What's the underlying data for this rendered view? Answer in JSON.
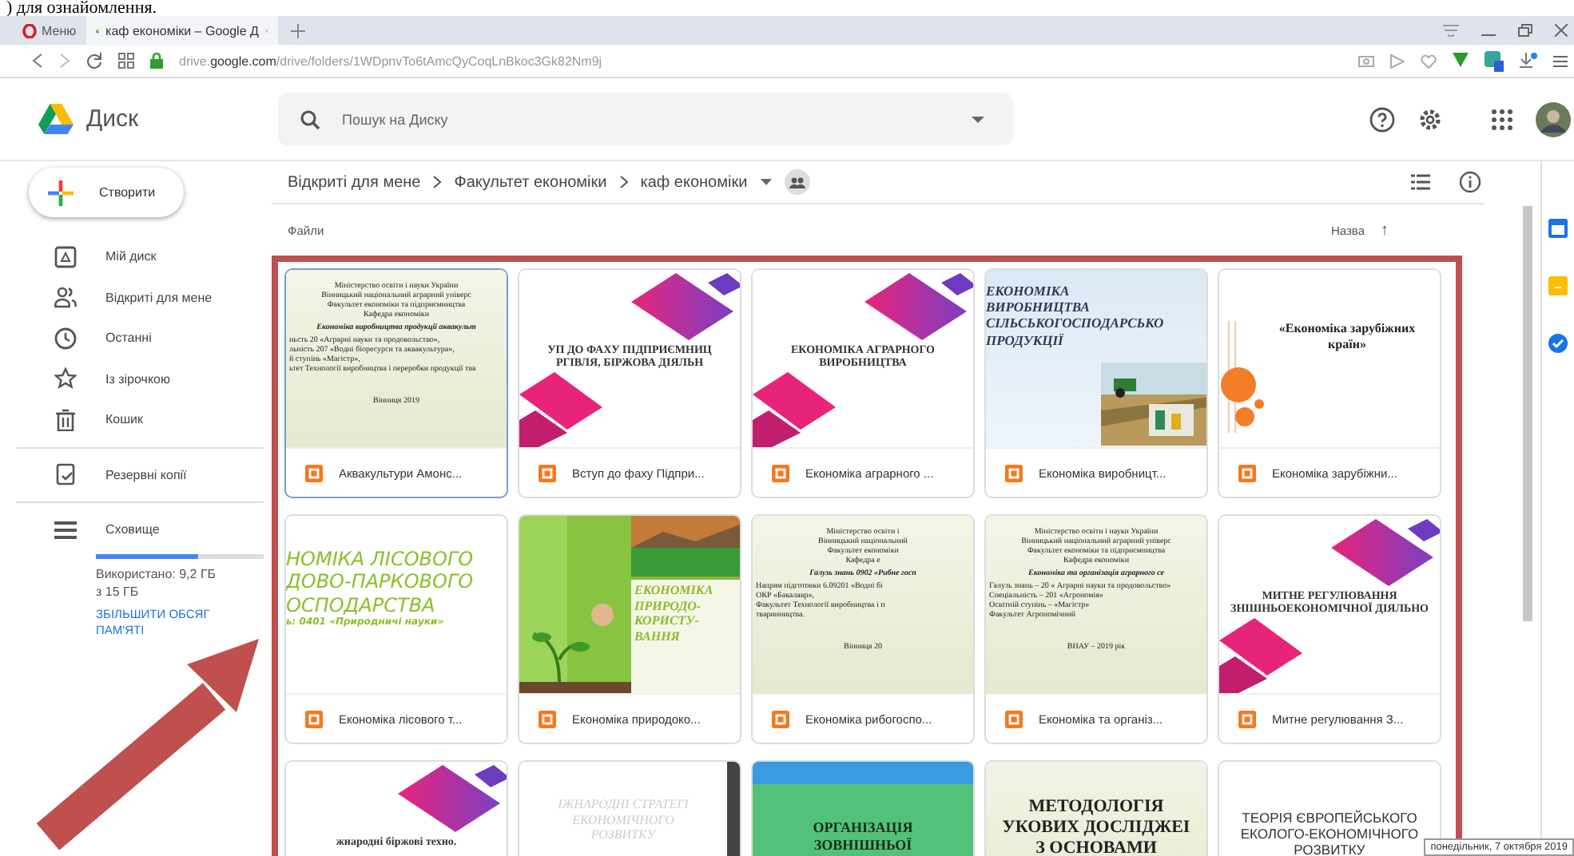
{
  "document_caption": ") для ознайомлення.",
  "browser": {
    "menu_label": "Меню",
    "tabs": [
      {
        "title": "каф економіки – Google Д",
        "selected": true
      }
    ],
    "address": "drive.**google.com**/drive/folders/1WDpnvTo6tAmcQyCoqLnBkoc3Gk82Nm9j"
  },
  "app": {
    "name": "Диск",
    "search": {
      "placeholder": "Пошук на Диску"
    }
  },
  "sidebar": {
    "create_label": "Створити",
    "items": [
      {
        "label": "Мій диск",
        "selected": false
      },
      {
        "label": "Відкриті для мене",
        "selected": false
      },
      {
        "label": "Останні",
        "selected": false
      },
      {
        "label": "Із зірочкою",
        "selected": false
      },
      {
        "label": "Кошик",
        "selected": false
      }
    ],
    "backup_label": "Резервні копії",
    "storage": {
      "label": "Сховище",
      "level": 0.61,
      "usage": "Використано: 9,2 ГБ з 15 ГБ",
      "upgrade_link": "ЗБІЛЬШИТИ ОБСЯГ ПАМ'ЯТІ"
    }
  },
  "breadcrumb": [
    "Відкриті для мене",
    "Факультет економіки",
    "каф економіки"
  ],
  "files_heading": "Файли",
  "sort": {
    "label": "Назва",
    "arrow": "↑"
  },
  "files": [
    {
      "name": "Аквакультури Амонс...",
      "selected": true,
      "kind": "doc",
      "lines": [
        "Міністерство освіти і науки України",
        "Вінницький національний аграрний універс",
        "Факультет економіки та підприємництва",
        "Кафедра економіки",
        "Економіка виробництва продукції аквакульт",
        "ньсть    20 «Аграрні науки та продовольство»,",
        "льність    207 «Водні біоресурси та аквакультура»,",
        "й ступінь  «Магістр»,",
        "ьтет Технології виробництва і переробки продукції тва",
        "Вінниця 2019"
      ]
    },
    {
      "name": "Вступ до фаху Підпри...",
      "selected": false,
      "kind": "pink",
      "lines": [
        "УП ДО ФАХУ ПІДПРИЄМНИЦ",
        "РГІВЛЯ, БІРЖОВА ДІЯЛЬН"
      ]
    },
    {
      "name": "Економіка аграрного ...",
      "selected": false,
      "kind": "pink",
      "lines": [
        "ЕКОНОМІКА АГРАРНОГО",
        "ВИРОБНИЦТВА"
      ]
    },
    {
      "name": "Економіка виробницт...",
      "selected": false,
      "kind": "blue",
      "lines": [
        "ЕКОНОМІКА",
        "ВИРОБНИЦТВА",
        "СІЛЬСЬКОГОСПОДАРСЬКО",
        "ПРОДУКЦІЇ"
      ]
    },
    {
      "name": "Економіка зарубіжни...",
      "selected": false,
      "kind": "orange",
      "lines": [
        "«Економіка зарубіжних",
        "країн»"
      ]
    },
    {
      "name": "Економіка лісового т...",
      "selected": false,
      "kind": "lime",
      "lines": [
        "НОМІКА ЛІСОВОГО",
        "ДОВО-ПАРКОВОГО",
        "ОСПОДАРСТВА",
        "ь: 0401 «Природничі науки»"
      ]
    },
    {
      "name": "Економіка природоко...",
      "selected": false,
      "kind": "eco",
      "lines": [
        "ЕКОНОМІКА",
        "ПРИРОДО-",
        "КОРИСТУ-",
        "ВАННЯ"
      ]
    },
    {
      "name": "Економіка рибогоспо...",
      "selected": false,
      "kind": "doc",
      "lines": [
        "Міністерство освіти і",
        "Вінницький національний",
        "Факультет економіки",
        "Кафедра е",
        "Галузь знань      0902 «Рибне госп",
        "Напрям підготовки   6.09201 «Водні бі",
        "ОКР «Бакалавр»,",
        "Факультет Технології виробництва і п",
        "тваринництва.",
        "Вінниця 20"
      ]
    },
    {
      "name": "Економіка та організ...",
      "selected": false,
      "kind": "doc",
      "lines": [
        "Міністерство освіти і науки України",
        "Вінницький національний аграрний універс",
        "Факультет економіки та підприємництва",
        "Кафедра економіки",
        "Економіка та організація аграрного се",
        "Галузь знань – 20 « Аграрні науки та продовольство»",
        "Спеціальність –  201 «Агрономія»",
        "Освітній ступінь – «Магістр»",
        "Факультет Агрономічний",
        "ВНАУ – 2019 рік"
      ]
    },
    {
      "name": "Митне регулювання З...",
      "selected": false,
      "kind": "pink",
      "lines": [
        "МИТНЕ РЕГУЛЮВАННЯ",
        "ЗНІШНЬОЕКОНОМІЧНОЇ ДІЯЛЬНО"
      ]
    },
    {
      "selected": false,
      "kind": "pinktop",
      "lines": [
        "жнародні    біржові    техно."
      ]
    },
    {
      "selected": false,
      "kind": "faint",
      "lines": [
        "ІЖНАРОДНІ СТРАТЕГІ",
        "ЕКОНОМІЧНОГО",
        "РОЗВИТКУ"
      ]
    },
    {
      "selected": false,
      "kind": "green",
      "lines": [
        "ОРГАНІЗАЦІЯ",
        "ЗОВНІШНЬОЇ"
      ]
    },
    {
      "selected": false,
      "kind": "beige",
      "lines": [
        "МЕТОДОЛОГІЯ",
        "УКОВИХ ДОСЛІДЖЕІ",
        "З ОСНОВАМИ"
      ]
    },
    {
      "selected": false,
      "kind": "plain",
      "lines": [
        "ТЕОРІЯ ЄВРОПЕЙСЬКОГО",
        "ЕКОЛОГО-ЕКОНОМІЧНОГО",
        "РОЗВИТКУ"
      ]
    }
  ],
  "tooltip": "понедільник, 7 октября 2019"
}
